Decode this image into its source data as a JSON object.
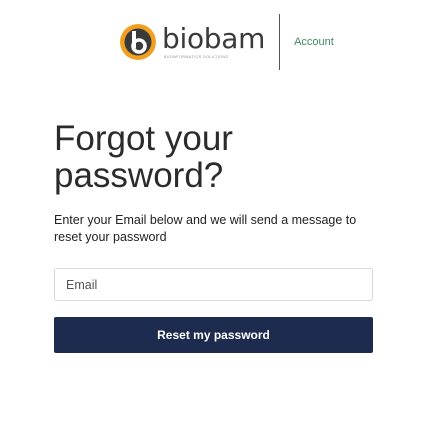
{
  "header": {
    "logo_text": "biobam",
    "logo_tagline": "bioinformatics solutions",
    "account_link": "Account"
  },
  "main": {
    "title": "Forgot your password?",
    "description": "Enter your Email below and we will send a message to reset your password",
    "email_placeholder": "Email",
    "email_value": "",
    "reset_button_label": "Reset my password"
  },
  "colors": {
    "brand_orange": "#f0a020",
    "brand_dark": "#3a3a3a",
    "account_green": "#3f8a64",
    "button_navy": "#1d2c4e"
  },
  "icons": {
    "logo": "biobam-logo-icon"
  }
}
